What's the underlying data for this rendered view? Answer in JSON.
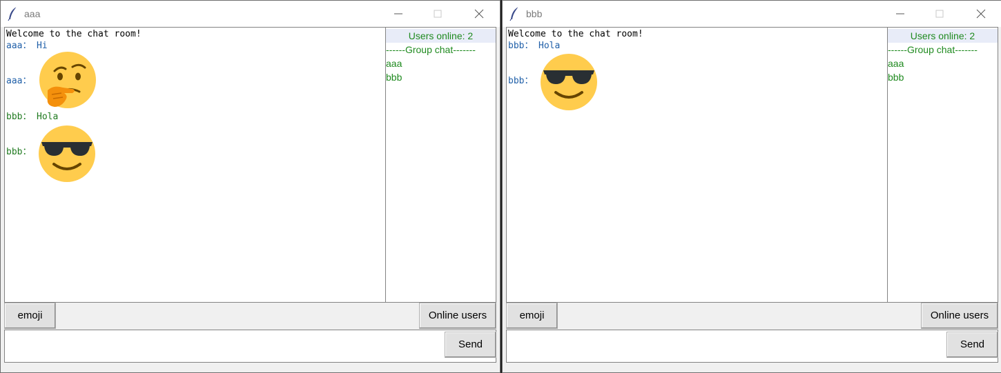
{
  "windows": [
    {
      "title": "aaa",
      "welcome": "Welcome to the chat room!",
      "messages": [
        {
          "sender": "aaa：",
          "text": "Hi",
          "color": "#1f5fa8"
        },
        {
          "sender": "aaa：",
          "emoji": "thinking-face",
          "color": "#1f5fa8"
        },
        {
          "sender": "bbb：",
          "text": "Hola",
          "color": "#1f7a1f"
        },
        {
          "sender": "bbb：",
          "emoji": "sunglasses-face",
          "color": "#1f7a1f"
        }
      ],
      "users_header": "Users online: 2",
      "group_chat": "------Group chat-------",
      "users": [
        "aaa",
        "bbb"
      ],
      "buttons": {
        "emoji": "emoji",
        "online": "Online users",
        "send": "Send"
      },
      "input_value": ""
    },
    {
      "title": "bbb",
      "welcome": "Welcome to the chat room!",
      "messages": [
        {
          "sender": "bbb：",
          "text": "Hola",
          "color": "#1f5fa8"
        },
        {
          "sender": "bbb：",
          "emoji": "sunglasses-face",
          "color": "#1f5fa8"
        }
      ],
      "users_header": "Users online: 2",
      "group_chat": "------Group chat-------",
      "users": [
        "aaa",
        "bbb"
      ],
      "buttons": {
        "emoji": "emoji",
        "online": "Online users",
        "send": "Send"
      },
      "input_value": ""
    }
  ],
  "colors": {
    "sender_self": "#1f5fa8",
    "sender_other": "#1f7a1f",
    "users_text": "#1f8a1f",
    "users_header_bg": "#e8ecf8"
  }
}
